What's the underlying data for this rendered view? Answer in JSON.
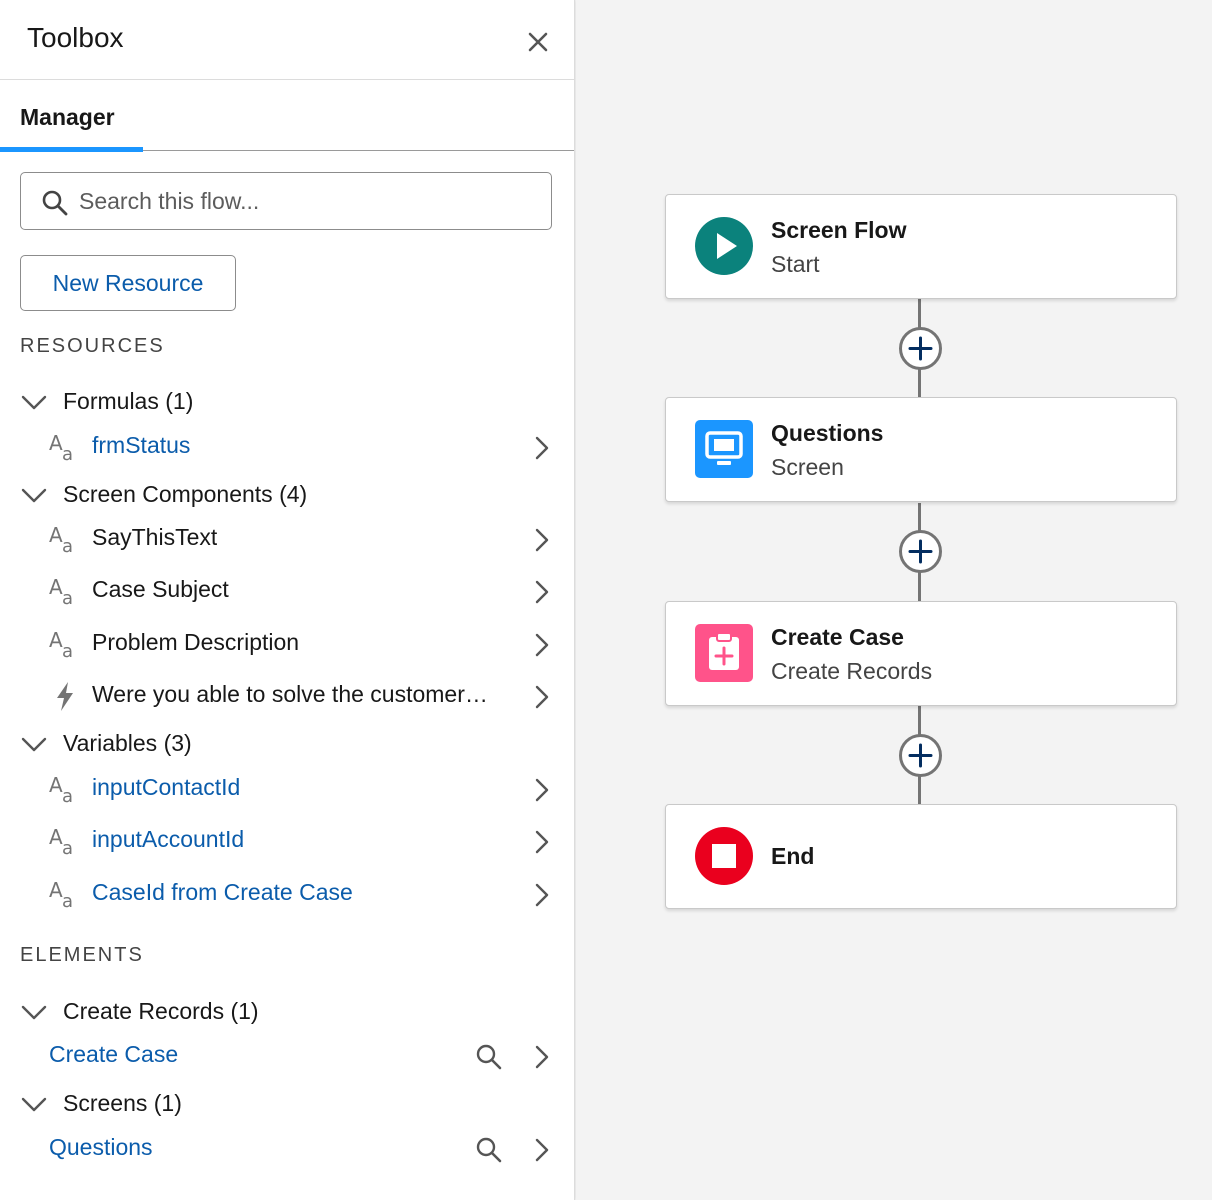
{
  "toolbox": {
    "title": "Toolbox",
    "tab_label": "Manager",
    "search_placeholder": "Search this flow...",
    "new_resource_label": "New Resource"
  },
  "resources": {
    "section_title": "RESOURCES",
    "formulas": {
      "label": "Formulas (1)",
      "items": [
        {
          "label": "frmStatus"
        }
      ]
    },
    "screen_components": {
      "label": "Screen Components (4)",
      "items": [
        {
          "label": "SayThisText"
        },
        {
          "label": "Case Subject"
        },
        {
          "label": "Problem Description"
        },
        {
          "label": "Were you able to solve the customer…"
        }
      ]
    },
    "variables": {
      "label": "Variables (3)",
      "items": [
        {
          "label": "inputContactId"
        },
        {
          "label": "inputAccountId"
        },
        {
          "label": "CaseId from Create Case"
        }
      ]
    }
  },
  "elements": {
    "section_title": "ELEMENTS",
    "create_records": {
      "label": "Create Records (1)",
      "items": [
        {
          "label": "Create Case"
        }
      ]
    },
    "screens": {
      "label": "Screens (1)",
      "items": [
        {
          "label": "Questions"
        }
      ]
    }
  },
  "flow": {
    "nodes": [
      {
        "title": "Screen Flow",
        "subtitle": "Start",
        "icon": "play-icon",
        "color": "#0b827c"
      },
      {
        "title": "Questions",
        "subtitle": "Screen",
        "icon": "screen-icon",
        "color": "#1b96ff"
      },
      {
        "title": "Create Case",
        "subtitle": "Create Records",
        "icon": "record-create-icon",
        "color": "#ff538a"
      },
      {
        "title": "End",
        "subtitle": "",
        "icon": "stop-icon",
        "color": "#ea001e"
      }
    ]
  },
  "colors": {
    "link": "#0b5cab",
    "tab_accent": "#1b96ff"
  }
}
